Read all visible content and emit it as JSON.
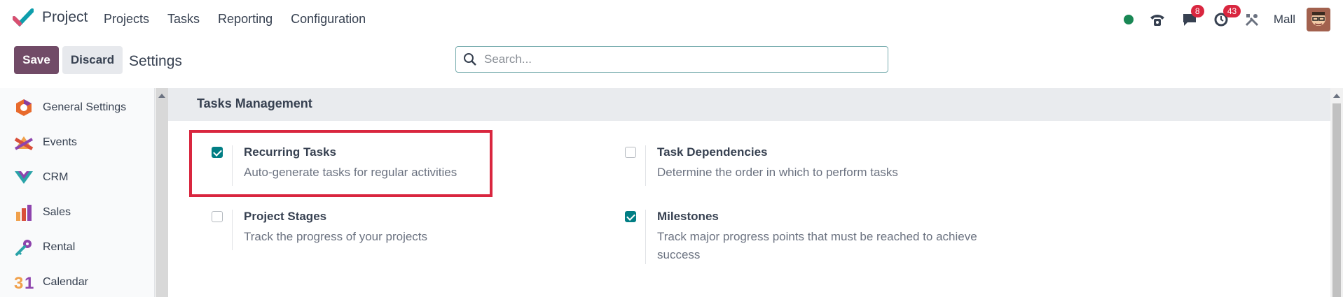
{
  "app": {
    "name": "Project"
  },
  "nav": {
    "menu": [
      "Projects",
      "Tasks",
      "Reporting",
      "Configuration"
    ]
  },
  "systray": {
    "status_color": "#198754",
    "phone_icon": "phone-icon",
    "messages_badge": "8",
    "activities_badge": "43",
    "tools_icon": "tools-icon",
    "user_name": "Mall"
  },
  "control": {
    "save_label": "Save",
    "discard_label": "Discard",
    "breadcrumb": "Settings",
    "search_placeholder": "Search..."
  },
  "sidebar": {
    "items": [
      {
        "label": "General Settings",
        "icon": "general-settings-icon"
      },
      {
        "label": "Events",
        "icon": "events-icon"
      },
      {
        "label": "CRM",
        "icon": "crm-icon"
      },
      {
        "label": "Sales",
        "icon": "sales-icon"
      },
      {
        "label": "Rental",
        "icon": "rental-icon"
      },
      {
        "label": "Calendar",
        "icon": "calendar-icon"
      }
    ]
  },
  "section": {
    "title": "Tasks Management",
    "settings": [
      {
        "title": "Recurring Tasks",
        "description": "Auto-generate tasks for regular activities",
        "checked": true
      },
      {
        "title": "Task Dependencies",
        "description": "Determine the order in which to perform tasks",
        "checked": false
      },
      {
        "title": "Project Stages",
        "description": "Track the progress of your projects",
        "checked": false
      },
      {
        "title": "Milestones",
        "description": "Track major progress points that must be reached to achieve success",
        "checked": true
      }
    ]
  },
  "colors": {
    "brand": "#714b67",
    "accent": "#017e84",
    "highlight": "#d9263f"
  }
}
